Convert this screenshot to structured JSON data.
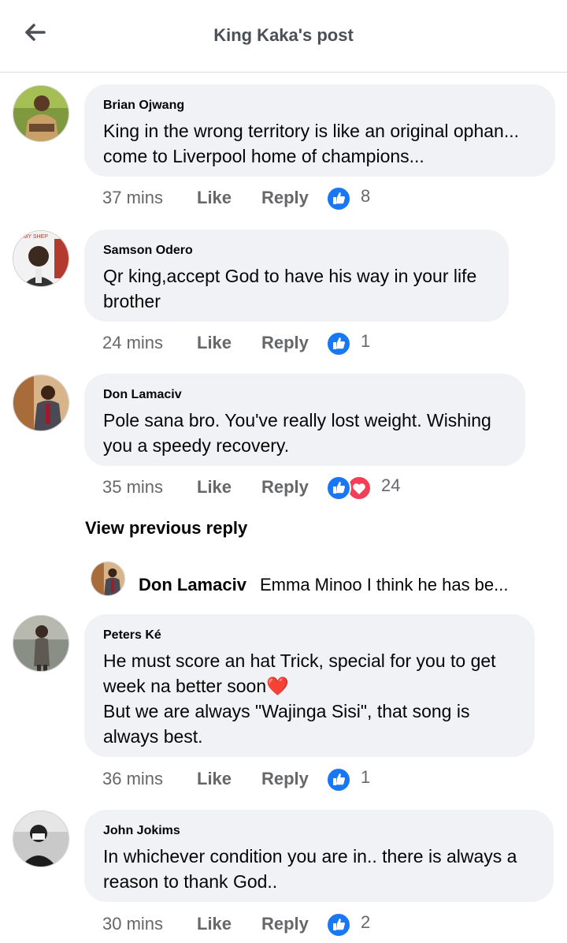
{
  "header": {
    "title": "King Kaka's post"
  },
  "comments": [
    {
      "author": "Brian Ojwang",
      "text": "King in the wrong territory is like an original ophan...\ncome to Liverpool home of champions...",
      "time": "37 mins",
      "like_label": "Like",
      "reply_label": "Reply",
      "reactions": [
        "like-icon"
      ],
      "reaction_count": "8"
    },
    {
      "author": "Samson Odero",
      "text": "Qr king,accept God to have his way in your life\nbrother",
      "time": "24 mins",
      "like_label": "Like",
      "reply_label": "Reply",
      "reactions": [
        "like-icon"
      ],
      "reaction_count": "1",
      "avatar_banner_text": "IS MY SHEP"
    },
    {
      "author": "Don Lamaciv",
      "text": "Pole sana bro. You've really lost weight. Wishing\nyou a speedy recovery.",
      "time": "35 mins",
      "like_label": "Like",
      "reply_label": "Reply",
      "reactions": [
        "like-icon",
        "love-icon"
      ],
      "reaction_count": "24"
    },
    {
      "author": "Peters Ké",
      "text": "He must score an hat Trick, special for you to get\nweek na better soon❤️\nBut we are always \"Wajinga Sisi\", that song is\nalways best.",
      "time": "36 mins",
      "like_label": "Like",
      "reply_label": "Reply",
      "reactions": [
        "like-icon"
      ],
      "reaction_count": "1"
    },
    {
      "author": "John Jokims",
      "text": "In whichever condition you are in.. there is always a\nreason to thank God..",
      "time": "30 mins",
      "like_label": "Like",
      "reply_label": "Reply",
      "reactions": [
        "like-icon"
      ],
      "reaction_count": "2"
    }
  ],
  "view_previous_reply": "View previous reply",
  "reply_preview": {
    "author": "Don Lamaciv",
    "text": "Emma Minoo I think he has be..."
  },
  "colors": {
    "like_blue": "#1877f2",
    "love_red": "#f33e58",
    "bubble_bg": "#f0f2f5",
    "meta_gray": "#65676b"
  }
}
